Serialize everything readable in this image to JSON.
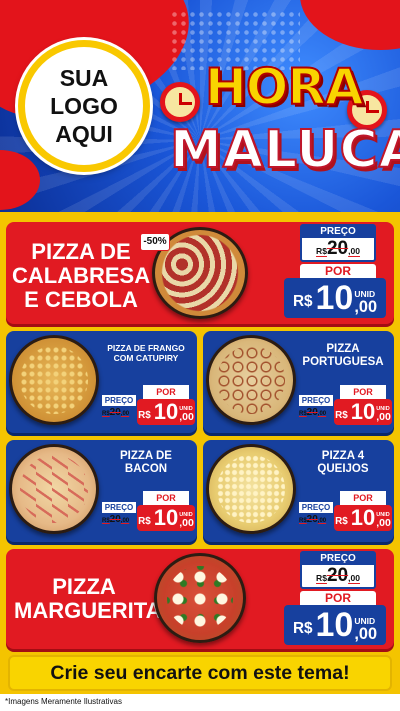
{
  "logo": {
    "text": "SUA\nLOGO\nAQUI"
  },
  "title": {
    "line1": "HORA",
    "line2": "MALUCA"
  },
  "featured_top": {
    "name": "PIZZA DE\nCALABRESA\nE CEBOLA",
    "discount": "-50%",
    "preco_label": "PREÇO",
    "old_currency": "R$",
    "old_int": "20",
    "old_cents": ",00",
    "por_label": "POR",
    "new_currency": "R$",
    "new_int": "10",
    "new_unit": "UNID",
    "new_cents": ",00"
  },
  "items": [
    {
      "name": "PIZZA DE FRANGO\nCOM CATUPIRY",
      "preco_label": "PREÇO",
      "old_currency": "R$",
      "old_int": "20",
      "old_cents": ",00",
      "por_label": "POR",
      "new_currency": "R$",
      "new_int": "10",
      "new_unit": "UNID",
      "new_cents": ",00"
    },
    {
      "name": "PIZZA\nPORTUGUESA",
      "preco_label": "PREÇO",
      "old_currency": "R$",
      "old_int": "20",
      "old_cents": ",00",
      "por_label": "POR",
      "new_currency": "R$",
      "new_int": "10",
      "new_unit": "UNID",
      "new_cents": ",00"
    },
    {
      "name": "PIZZA DE\nBACON",
      "preco_label": "PREÇO",
      "old_currency": "R$",
      "old_int": "20",
      "old_cents": ",00",
      "por_label": "POR",
      "new_currency": "R$",
      "new_int": "10",
      "new_unit": "UNID",
      "new_cents": ",00"
    },
    {
      "name": "PIZZA 4\nQUEIJOS",
      "preco_label": "PREÇO",
      "old_currency": "R$",
      "old_int": "20",
      "old_cents": ",00",
      "por_label": "POR",
      "new_currency": "R$",
      "new_int": "10",
      "new_unit": "UNID",
      "new_cents": ",00"
    }
  ],
  "featured_bottom": {
    "name": "PIZZA\nMARGUERITA",
    "preco_label": "PREÇO",
    "old_currency": "R$",
    "old_int": "20",
    "old_cents": ",00",
    "por_label": "POR",
    "new_currency": "R$",
    "new_int": "10",
    "new_unit": "UNID",
    "new_cents": ",00"
  },
  "cta": "Crie seu encarte com este tema!",
  "disclaimer": "*Imagens Meramente Ilustrativas",
  "colors": {
    "red": "#e11a22",
    "blue": "#17409e",
    "yellow": "#f9d400",
    "background": "#f4c400"
  }
}
